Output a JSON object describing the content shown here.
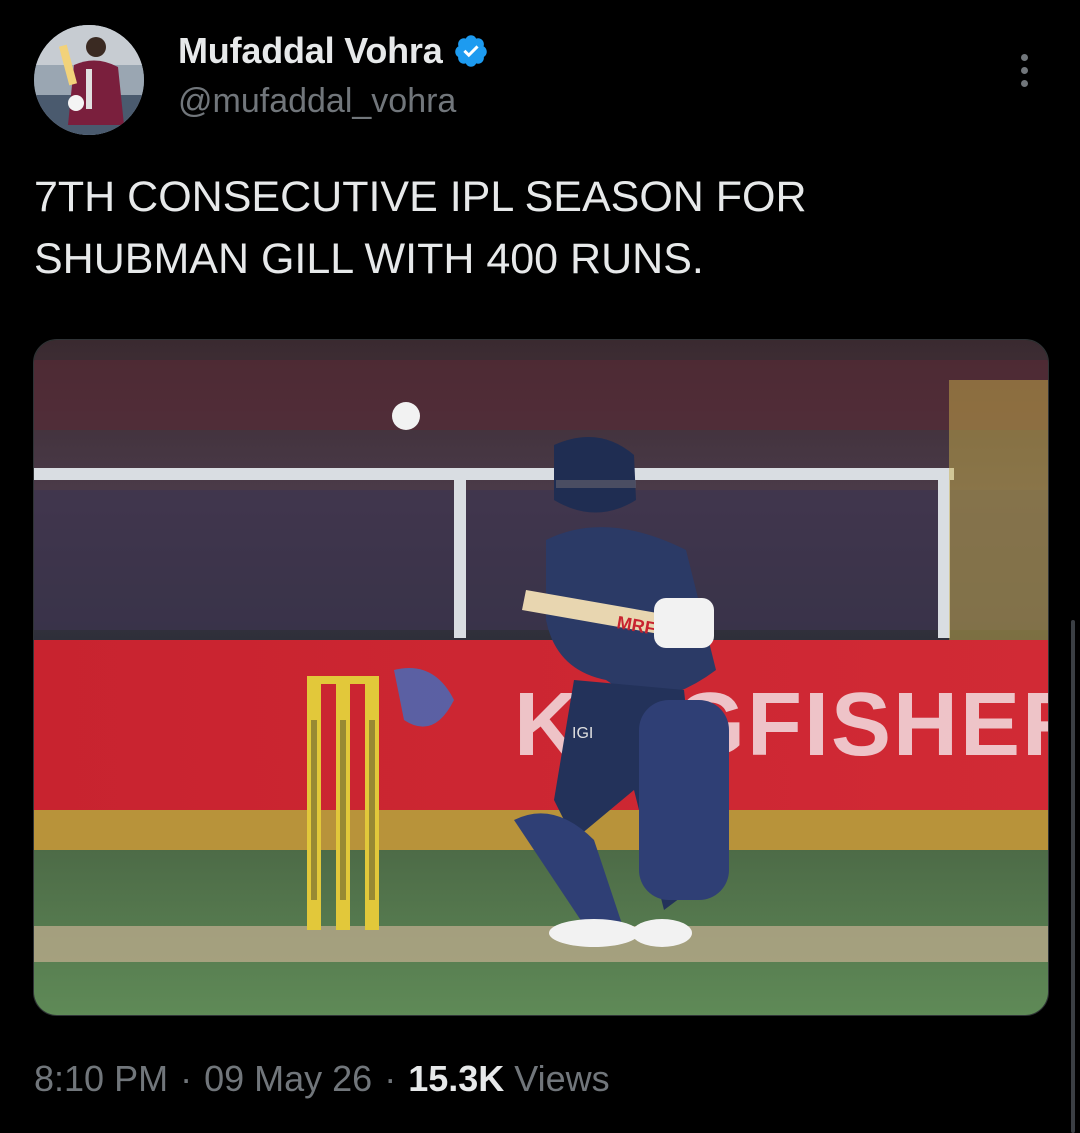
{
  "author": {
    "display_name": "Mufaddal Vohra",
    "handle": "@mufaddal_vohra",
    "verified": true,
    "verified_color": "#1d9bf0",
    "avatar_icon": "profile-photo"
  },
  "more_icon": "more-dots-vertical-icon",
  "tweet": {
    "text": "7TH CONSECUTIVE IPL SEASON FOR\nSHUBMAN GILL WITH 400 RUNS.",
    "media": {
      "description_icon": "cricket-photo",
      "board_text": "KINGFISHER",
      "bat_text": "MRF",
      "shirt_text": "IGI"
    }
  },
  "meta": {
    "time": "8:10 PM",
    "separator": "·",
    "date": "09 May 26",
    "views_count": "15.3K",
    "views_label": "Views"
  },
  "colors": {
    "background": "#000000",
    "primary_text": "#e7e9ea",
    "secondary_text": "#71767b"
  }
}
